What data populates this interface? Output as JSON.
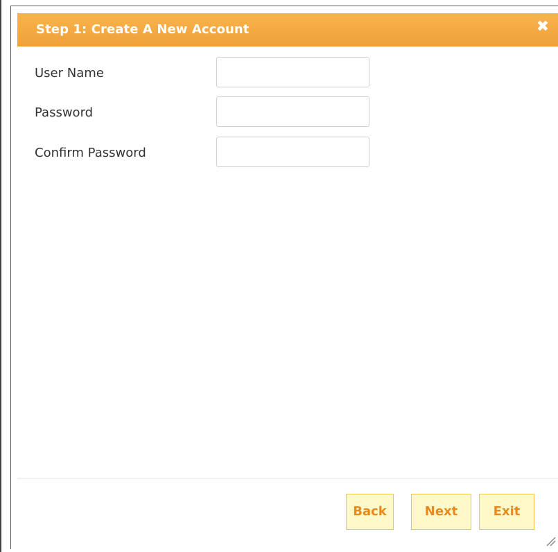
{
  "dialog": {
    "title": "Step 1: Create A New Account",
    "close_icon": "close-icon",
    "accent_color": "#f0a03a"
  },
  "form": {
    "fields": [
      {
        "label": "User Name",
        "value": "",
        "placeholder": ""
      },
      {
        "label": "Password",
        "value": "",
        "placeholder": ""
      },
      {
        "label": "Confirm Password",
        "value": "",
        "placeholder": ""
      }
    ]
  },
  "footer": {
    "back_label": "Back",
    "next_label": "Next",
    "exit_label": "Exit"
  }
}
